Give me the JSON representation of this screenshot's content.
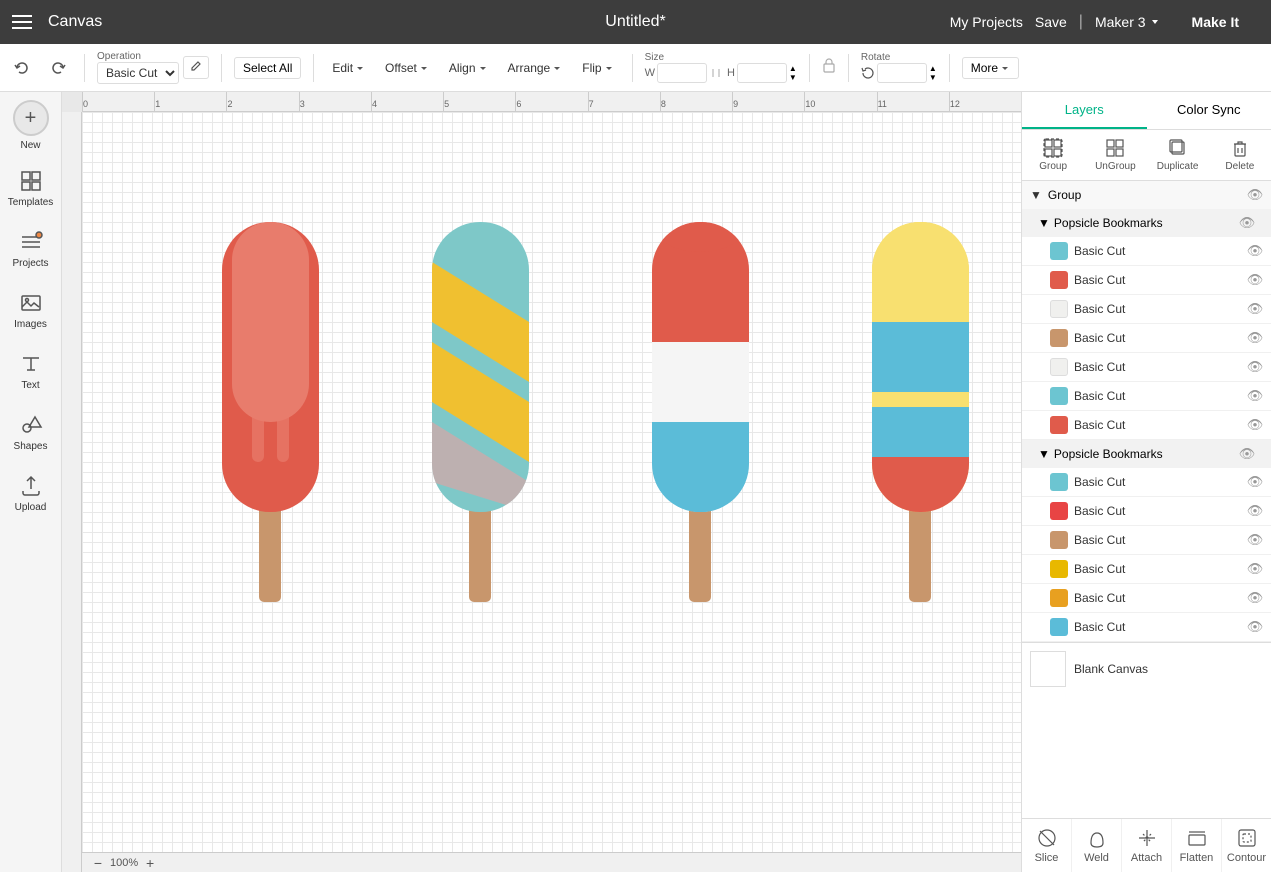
{
  "topbar": {
    "app_title": "Canvas",
    "doc_title": "Untitled*",
    "my_projects": "My Projects",
    "save": "Save",
    "separator": "|",
    "maker": "Maker 3",
    "make_it": "Make It"
  },
  "toolbar": {
    "operation_label": "Operation",
    "operation_value": "Basic Cut",
    "select_all": "Select All",
    "edit": "Edit",
    "offset": "Offset",
    "align": "Align",
    "arrange": "Arrange",
    "flip": "Flip",
    "size": "Size",
    "w_label": "W",
    "h_label": "H",
    "w_value": "",
    "h_value": "",
    "rotate_label": "Rotate",
    "rotate_value": "",
    "more": "More"
  },
  "left_sidebar": {
    "new_label": "New",
    "items": [
      {
        "id": "templates",
        "label": "Templates",
        "icon": "grid"
      },
      {
        "id": "projects",
        "label": "Projects",
        "icon": "folder"
      },
      {
        "id": "images",
        "label": "Images",
        "icon": "image"
      },
      {
        "id": "text",
        "label": "Text",
        "icon": "text"
      },
      {
        "id": "shapes",
        "label": "Shapes",
        "icon": "shapes"
      },
      {
        "id": "upload",
        "label": "Upload",
        "icon": "upload"
      }
    ]
  },
  "canvas": {
    "zoom": "100%",
    "ruler_marks": [
      "0",
      "1",
      "2",
      "3",
      "4",
      "5",
      "6",
      "7",
      "8",
      "9",
      "10",
      "11",
      "12"
    ]
  },
  "right_panel": {
    "tabs": [
      {
        "id": "layers",
        "label": "Layers"
      },
      {
        "id": "color_sync",
        "label": "Color Sync"
      }
    ],
    "active_tab": "layers",
    "layer_actions": [
      {
        "id": "group",
        "label": "Group"
      },
      {
        "id": "ungroup",
        "label": "UnGroup"
      },
      {
        "id": "duplicate",
        "label": "Duplicate"
      },
      {
        "id": "delete",
        "label": "Delete"
      }
    ],
    "groups": [
      {
        "id": "group1",
        "label": "Group",
        "children": [
          {
            "id": "pb1",
            "label": "Popsicle Bookmarks",
            "items": [
              {
                "id": "bc1",
                "label": "Basic Cut",
                "color": "#6cc5d1",
                "visible": true
              },
              {
                "id": "bc2",
                "label": "Basic Cut",
                "color": "#e05b4b",
                "visible": true
              },
              {
                "id": "bc3",
                "label": "Basic Cut",
                "color": "#f0f0ee",
                "visible": true
              },
              {
                "id": "bc4",
                "label": "Basic Cut",
                "color": "#c8966c",
                "visible": true
              },
              {
                "id": "bc5",
                "label": "Basic Cut",
                "color": "#f0f0ee",
                "visible": true
              },
              {
                "id": "bc6",
                "label": "Basic Cut",
                "color": "#6cc5d1",
                "visible": true
              },
              {
                "id": "bc7",
                "label": "Basic Cut",
                "color": "#e05b4b",
                "visible": true
              }
            ]
          },
          {
            "id": "pb2",
            "label": "Popsicle Bookmarks",
            "items": [
              {
                "id": "bc8",
                "label": "Basic Cut",
                "color": "#6cc5d1",
                "visible": true
              },
              {
                "id": "bc9",
                "label": "Basic Cut",
                "color": "#e84444",
                "visible": true
              },
              {
                "id": "bc10",
                "label": "Basic Cut",
                "color": "#c8966c",
                "visible": true
              },
              {
                "id": "bc11",
                "label": "Basic Cut",
                "color": "#e8b800",
                "visible": true
              },
              {
                "id": "bc12",
                "label": "Basic Cut",
                "color": "#e8a020",
                "visible": true
              },
              {
                "id": "bc13",
                "label": "Basic Cut",
                "color": "#5bbcd8",
                "visible": true
              }
            ]
          }
        ]
      }
    ],
    "blank_canvas": {
      "label": "Blank Canvas"
    },
    "bottom_tools": [
      {
        "id": "slice",
        "label": "Slice"
      },
      {
        "id": "weld",
        "label": "Weld"
      },
      {
        "id": "attach",
        "label": "Attach"
      },
      {
        "id": "flatten",
        "label": "Flatten"
      },
      {
        "id": "contour",
        "label": "Contour"
      }
    ]
  }
}
